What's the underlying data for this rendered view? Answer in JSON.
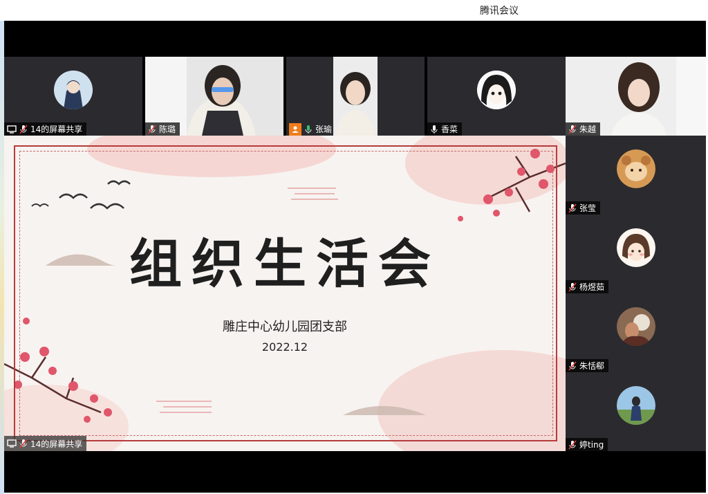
{
  "window": {
    "title": "腾讯会议"
  },
  "top_row": [
    {
      "name": "14的屏幕共享",
      "type": "screen-share",
      "mic": "muted"
    },
    {
      "name": "陈璐",
      "type": "video",
      "mic": "muted"
    },
    {
      "name": "张瑜",
      "type": "video",
      "mic": "on"
    },
    {
      "name": "香菜",
      "type": "avatar",
      "mic": "on"
    },
    {
      "name": "朱越",
      "type": "video",
      "mic": "muted"
    }
  ],
  "side_list": [
    {
      "name": "张莹",
      "mic": "muted"
    },
    {
      "name": "杨煜茹",
      "mic": "muted"
    },
    {
      "name": "朱恬郗",
      "mic": "muted"
    },
    {
      "name": "婷ting",
      "mic": "muted"
    }
  ],
  "slide": {
    "title": "组织生活会",
    "subtitle": "雕庄中心幼儿园团支部",
    "date": "2022.12"
  },
  "share_label": "14的屏幕共享",
  "colors": {
    "frame": "#b53b3b",
    "blossom": "#e0566a",
    "tile_bg": "#2b2b2f",
    "meeting_bg": "#000000"
  }
}
